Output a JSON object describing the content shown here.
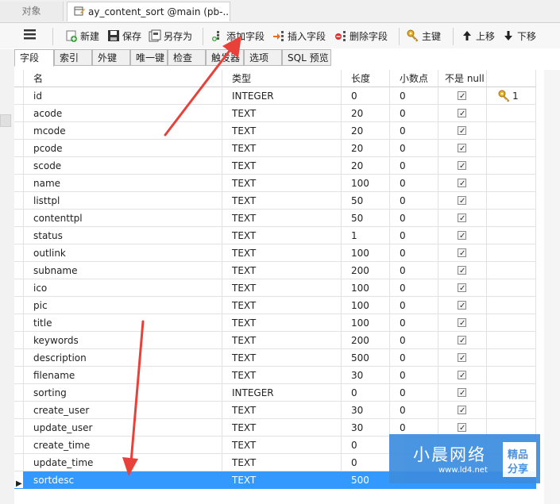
{
  "doc_tabs": [
    {
      "label": "对象"
    },
    {
      "label": "ay_content_sort @main (pb-..."
    }
  ],
  "toolbar": {
    "menu_icon": "hamburger-icon",
    "new_label": "新建",
    "save_label": "保存",
    "save_as_label": "另存为",
    "add_field_label": "添加字段",
    "insert_field_label": "插入字段",
    "delete_field_label": "删除字段",
    "primary_key_label": "主键",
    "move_up_label": "上移",
    "move_down_label": "下移"
  },
  "sub_tabs": [
    {
      "label": "字段"
    },
    {
      "label": "索引"
    },
    {
      "label": "外键"
    },
    {
      "label": "唯一键"
    },
    {
      "label": "检查"
    },
    {
      "label": "触发器"
    },
    {
      "label": "选项"
    },
    {
      "label": "SQL 预览"
    }
  ],
  "columns": [
    "名",
    "类型",
    "长度",
    "小数点",
    "不是 null",
    ""
  ],
  "rows": [
    {
      "name": "id",
      "type": "INTEGER",
      "length": "0",
      "decimal": "0",
      "not_null": true,
      "key": "1"
    },
    {
      "name": "acode",
      "type": "TEXT",
      "length": "20",
      "decimal": "0",
      "not_null": true
    },
    {
      "name": "mcode",
      "type": "TEXT",
      "length": "20",
      "decimal": "0",
      "not_null": true
    },
    {
      "name": "pcode",
      "type": "TEXT",
      "length": "20",
      "decimal": "0",
      "not_null": true
    },
    {
      "name": "scode",
      "type": "TEXT",
      "length": "20",
      "decimal": "0",
      "not_null": true
    },
    {
      "name": "name",
      "type": "TEXT",
      "length": "100",
      "decimal": "0",
      "not_null": true
    },
    {
      "name": "listtpl",
      "type": "TEXT",
      "length": "50",
      "decimal": "0",
      "not_null": true
    },
    {
      "name": "contenttpl",
      "type": "TEXT",
      "length": "50",
      "decimal": "0",
      "not_null": true
    },
    {
      "name": "status",
      "type": "TEXT",
      "length": "1",
      "decimal": "0",
      "not_null": true
    },
    {
      "name": "outlink",
      "type": "TEXT",
      "length": "100",
      "decimal": "0",
      "not_null": true
    },
    {
      "name": "subname",
      "type": "TEXT",
      "length": "200",
      "decimal": "0",
      "not_null": true
    },
    {
      "name": "ico",
      "type": "TEXT",
      "length": "100",
      "decimal": "0",
      "not_null": true
    },
    {
      "name": "pic",
      "type": "TEXT",
      "length": "100",
      "decimal": "0",
      "not_null": true
    },
    {
      "name": "title",
      "type": "TEXT",
      "length": "100",
      "decimal": "0",
      "not_null": true
    },
    {
      "name": "keywords",
      "type": "TEXT",
      "length": "200",
      "decimal": "0",
      "not_null": true
    },
    {
      "name": "description",
      "type": "TEXT",
      "length": "500",
      "decimal": "0",
      "not_null": true
    },
    {
      "name": "filename",
      "type": "TEXT",
      "length": "30",
      "decimal": "0",
      "not_null": true
    },
    {
      "name": "sorting",
      "type": "INTEGER",
      "length": "0",
      "decimal": "0",
      "not_null": true
    },
    {
      "name": "create_user",
      "type": "TEXT",
      "length": "30",
      "decimal": "0",
      "not_null": true
    },
    {
      "name": "update_user",
      "type": "TEXT",
      "length": "30",
      "decimal": "0",
      "not_null": true
    },
    {
      "name": "create_time",
      "type": "TEXT",
      "length": "0",
      "decimal": "",
      "not_null": false
    },
    {
      "name": "update_time",
      "type": "TEXT",
      "length": "0",
      "decimal": "",
      "not_null": false
    },
    {
      "name": "sortdesc",
      "type": "TEXT",
      "length": "500",
      "decimal": "",
      "not_null": false,
      "selected": true
    }
  ],
  "colors": {
    "selection": "#3399ff",
    "arrow": "#e8413a",
    "watermark_bg": "#3d8ddf"
  },
  "watermark": {
    "title": "小晨网络",
    "url": "www.ld4.net",
    "badge_line1": "精品",
    "badge_line2": "分享"
  }
}
